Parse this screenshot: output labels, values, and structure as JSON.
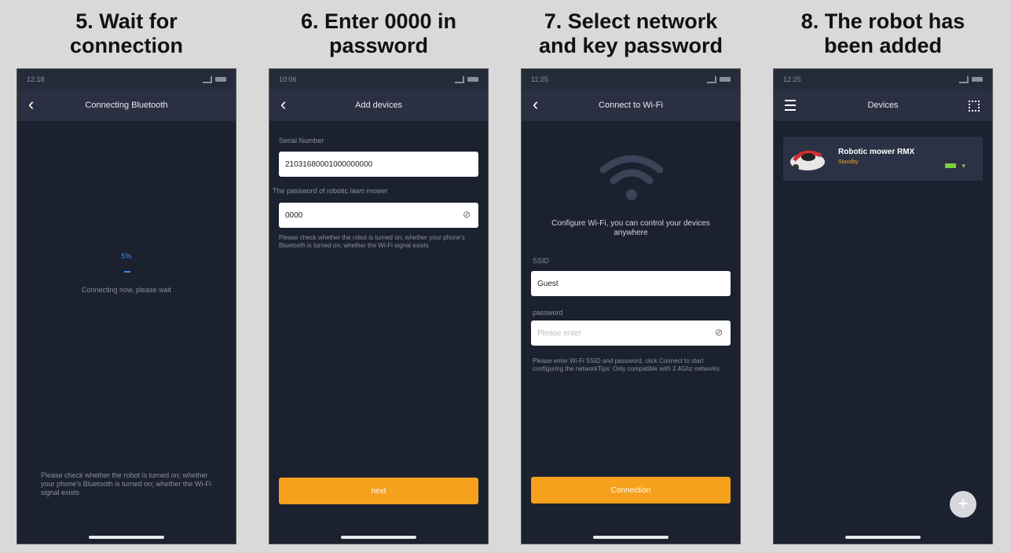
{
  "steps": [
    {
      "title_line1": "5. Wait for",
      "title_line2": "connection",
      "status_time": "12:18",
      "nav_title": "Connecting Bluetooth",
      "progress_percent": "5%",
      "connecting_text": "Connecting now, please wait",
      "help_text": "Please check whether the robot is turned on; whether your phone's Bluetooth is turned on; whether the Wi-Fi signal exists"
    },
    {
      "title_line1": "6.  Enter 0000 in",
      "title_line2": "password",
      "status_time": "10:06",
      "nav_title": "Add devices",
      "serial_label": "Serial Number",
      "serial_value": "21031680001000000000",
      "password_label": "The password of robotic lawn mower",
      "password_value": "0000",
      "help_text": "Please check whether the robot is turned on; whether your phone's Bluetooth is turned on; whether the Wi-Fi signal exists",
      "button_label": "next"
    },
    {
      "title_line1": "7. Select network",
      "title_line2": "and key password",
      "status_time": "11:25",
      "nav_title": "Connect to Wi-Fi",
      "configure_text": "Configure Wi-Fi, you can control your devices anywhere",
      "ssid_label": "SSID",
      "ssid_value": "Guest",
      "password_label": "password",
      "password_placeholder": "Please enter",
      "help_text": "Please enter Wi-Fi SSID and password, click Connect to start configuring the networkTips: Only compatible with 2.4Ghz networks",
      "button_label": "Connection"
    },
    {
      "title_line1": "8. The robot has",
      "title_line2": "been added",
      "status_time": "12:25",
      "nav_title": "Devices",
      "device_name": "Robotic mower RMX",
      "device_status": "Standby",
      "add_label": "+"
    }
  ],
  "colors": {
    "background": "#d9d9d9",
    "screen": "#1c2130",
    "navbar": "#2a3042",
    "accent": "#f5a11c",
    "progress": "#3b8fe8",
    "battery": "#7bd13c"
  },
  "icons": [
    "back-arrow-icon",
    "eye-off-icon",
    "wifi-icon",
    "menu-icon",
    "scan-icon",
    "battery-icon",
    "signal-icon",
    "mower-icon",
    "add-icon"
  ]
}
